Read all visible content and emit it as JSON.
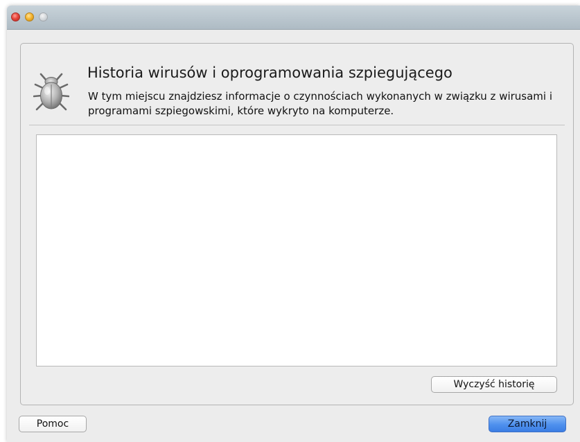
{
  "window": {
    "controls": {
      "close": "close-icon",
      "minimize": "minimize-icon",
      "zoom": "zoom-icon"
    }
  },
  "header": {
    "icon": "bug-icon",
    "title": "Historia wirusów i oprogramowania szpiegującego",
    "description": "W tym miejscu znajdziesz informacje o czynnościach wykonanych w związku z wirusami i programami szpiegowskimi, które wykryto na komputerze."
  },
  "history": {
    "items": []
  },
  "buttons": {
    "clear_history": "Wyczyść historię",
    "help": "Pomoc",
    "close": "Zamknij"
  },
  "colors": {
    "primary_button": "#4e90ee",
    "titlebar": "#aebbc4"
  }
}
